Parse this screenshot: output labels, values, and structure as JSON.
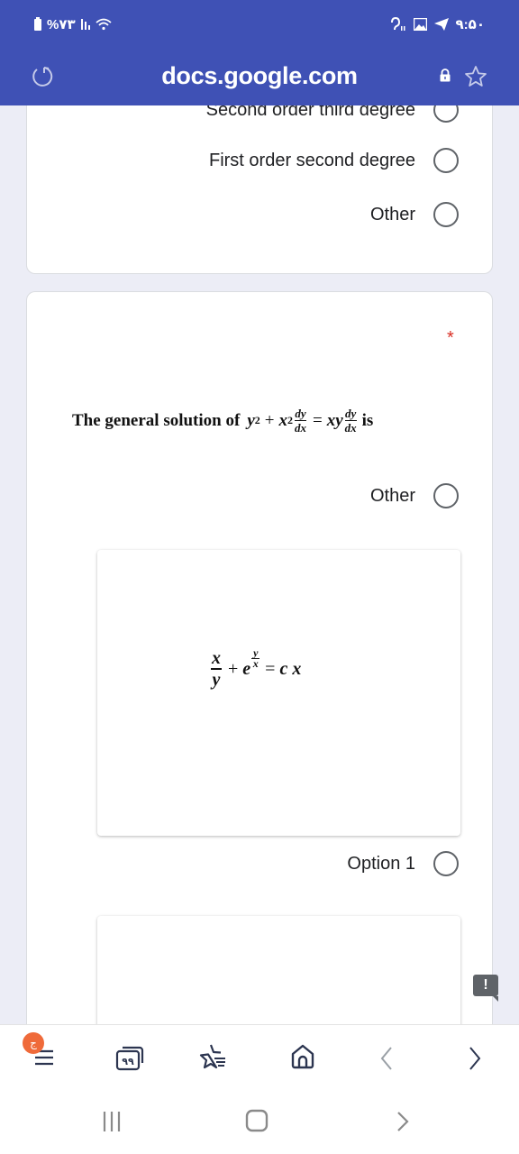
{
  "status_bar": {
    "battery": "%۷۳",
    "time": "۹:۵۰",
    "icons": [
      "battery-icon",
      "signal-icon",
      "wifi-icon",
      "accessibility-icon",
      "gallery-icon",
      "telegram-icon"
    ]
  },
  "browser": {
    "url": "docs.google.com",
    "icons": [
      "reload-icon",
      "lock-icon",
      "bookmark-star-icon"
    ]
  },
  "question1": {
    "options": [
      {
        "label": "Second order third degree",
        "selected": false
      },
      {
        "label": "First order second degree",
        "selected": false
      },
      {
        "label": "Other",
        "selected": false
      }
    ]
  },
  "question2": {
    "required_marker": "*",
    "text_prefix": "The general solution of",
    "equation": {
      "lhs_a": "y",
      "lhs_a_exp": "2",
      "plus": "+",
      "lhs_b": "x",
      "lhs_b_exp": "2",
      "deriv_num": "dy",
      "deriv_den": "dx",
      "equals": "=",
      "rhs": "xy"
    },
    "text_suffix": "is",
    "options": [
      {
        "label": "Other",
        "selected": false
      },
      {
        "label": "Option 1",
        "selected": false,
        "image_equation": {
          "frac_num": "x",
          "frac_den": "y",
          "plus": "+",
          "base": "e",
          "exp_num": "y",
          "exp_den": "x",
          "equals": "=",
          "rhs": "c x"
        }
      }
    ]
  },
  "feedback_button": "!",
  "toolbar": {
    "menu_badge": "ج",
    "tabs_count": "۹۹",
    "items": [
      "menu-icon",
      "tabs-icon",
      "bookmarks-icon",
      "home-icon",
      "back-icon",
      "forward-icon"
    ]
  },
  "system_nav": [
    "recent-apps-icon",
    "home-nav-icon",
    "back-nav-icon"
  ]
}
